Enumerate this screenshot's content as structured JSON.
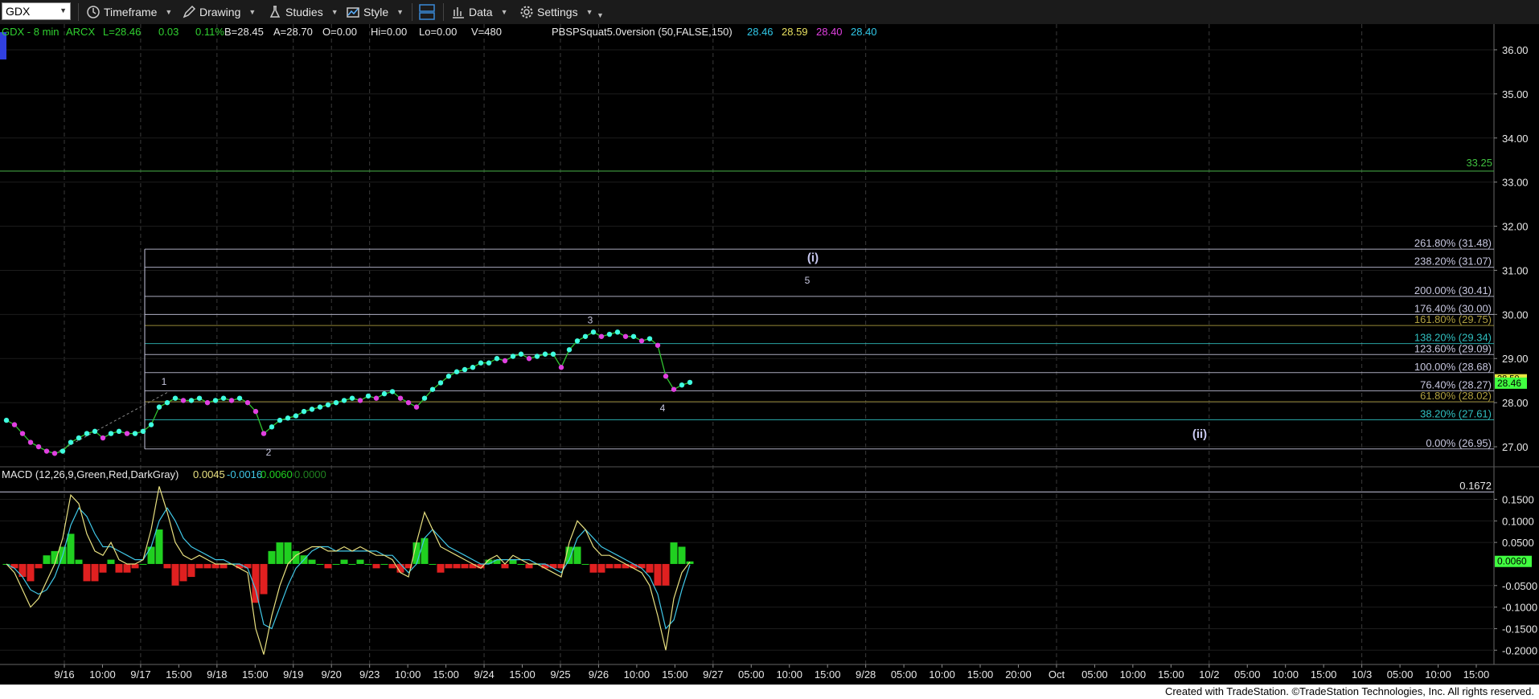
{
  "toolbar": {
    "symbol": "GDX",
    "items": [
      "Timeframe",
      "Drawing",
      "Studies",
      "Style",
      "Data",
      "Settings"
    ]
  },
  "header": {
    "instrument": "GDX - 8 min",
    "exchange": "ARCX",
    "last": "L=28.46",
    "change": "0.03",
    "change_pct": "0.11%",
    "bid": "B=28.45",
    "ask": "A=28.70",
    "ohlc": [
      "O=0.00",
      "Hi=0.00",
      "Lo=0.00",
      "V=480"
    ],
    "study_name": "PBSPSquat5.0version (50,FALSE,150)",
    "study_values": [
      "28.46",
      "28.59",
      "28.40",
      "28.40"
    ],
    "study_colors": [
      "#30c8e8",
      "#e8e060",
      "#e040e0",
      "#30c8e8"
    ]
  },
  "colors": {
    "up": "#00d8d8",
    "dot_up": "#40ffe0",
    "dot_dn": "#e040e0",
    "body": "#30c030",
    "fib_line": "#c8c8e0",
    "green_level": "#40a040",
    "last_price": "#40ff40",
    "hist_pos": "#20d020",
    "hist_neg": "#e02020",
    "macd_line": "#e8e080",
    "signal_line": "#40c8e8"
  },
  "chart_data": [
    {
      "type": "line",
      "title": "GDX - 8 min",
      "x_ticks": [
        "9/16",
        "10:00",
        "9/17",
        "15:00",
        "9/18",
        "15:00",
        "9/19",
        "9/20",
        "9/23",
        "10:00",
        "15:00",
        "9/24",
        "15:00",
        "9/25",
        "9/26",
        "10:00",
        "15:00",
        "9/27",
        "05:00",
        "10:00",
        "15:00",
        "9/28",
        "05:00",
        "10:00",
        "15:00",
        "20:00",
        "Oct",
        "05:00",
        "10:00",
        "15:00",
        "10/2",
        "05:00",
        "10:00",
        "15:00",
        "10/3",
        "05:00",
        "10:00",
        "15:00"
      ],
      "y_ticks": [
        "36.00",
        "35.00",
        "34.00",
        "33.00",
        "32.00",
        "31.00",
        "30.00",
        "29.00",
        "28.00",
        "27.00"
      ],
      "ylim": [
        26.6,
        36.4
      ],
      "series": [
        {
          "x": [
            0,
            1,
            2,
            3,
            4,
            5,
            6,
            7,
            8,
            9,
            10,
            11,
            12,
            13,
            14,
            15,
            16,
            17,
            18,
            19,
            20,
            21,
            22,
            23,
            24,
            25,
            26,
            27,
            28,
            29,
            30,
            31,
            32,
            33,
            34,
            35,
            36,
            37,
            38,
            39,
            40,
            41,
            42,
            43,
            44,
            45,
            46,
            47,
            48,
            49,
            50,
            51,
            52,
            53,
            54,
            55,
            56,
            57,
            58,
            59,
            60,
            61,
            62,
            63,
            64,
            65,
            66,
            67,
            68,
            69,
            70,
            71,
            72,
            73,
            74,
            75,
            76,
            77,
            78,
            79,
            80,
            81,
            82,
            83,
            84,
            85
          ],
          "values": [
            27.6,
            27.5,
            27.3,
            27.1,
            27.0,
            26.9,
            26.85,
            26.9,
            27.1,
            27.2,
            27.3,
            27.35,
            27.2,
            27.3,
            27.35,
            27.3,
            27.3,
            27.35,
            27.5,
            27.9,
            28.0,
            28.1,
            28.05,
            28.05,
            28.1,
            28.0,
            28.05,
            28.1,
            28.05,
            28.1,
            28.0,
            27.8,
            27.3,
            27.45,
            27.6,
            27.65,
            27.7,
            27.8,
            27.85,
            27.9,
            27.95,
            28.0,
            28.05,
            28.1,
            28.05,
            28.15,
            28.1,
            28.2,
            28.25,
            28.1,
            28.0,
            27.9,
            28.1,
            28.3,
            28.45,
            28.6,
            28.7,
            28.75,
            28.8,
            28.9,
            28.9,
            29.0,
            28.95,
            29.05,
            29.1,
            29.0,
            29.05,
            29.1,
            29.1,
            28.8,
            29.2,
            29.4,
            29.5,
            29.6,
            29.5,
            29.55,
            29.6,
            29.5,
            29.5,
            29.4,
            29.45,
            29.3,
            28.6,
            28.3,
            28.4,
            28.46
          ],
          "name": ""
        }
      ],
      "fib_levels": [
        {
          "label": "261.80% (31.48)",
          "value": 31.48
        },
        {
          "label": "238.20% (31.07)",
          "value": 31.07
        },
        {
          "label": "200.00% (30.41)",
          "value": 30.41
        },
        {
          "label": "176.40% (30.00)",
          "value": 30.0
        },
        {
          "label": "161.80% (29.75)",
          "value": 29.75
        },
        {
          "label": "138.20% (29.34)",
          "value": 29.34
        },
        {
          "label": "123.60% (29.09)",
          "value": 29.09
        },
        {
          "label": "100.00% (28.68)",
          "value": 28.68
        },
        {
          "label": "76.40% (28.27)",
          "value": 28.27
        },
        {
          "label": "61.80% (28.02)",
          "value": 28.02
        },
        {
          "label": "38.20% (27.61)",
          "value": 27.61
        },
        {
          "label": "0.00% (26.95)",
          "value": 26.95
        }
      ],
      "fib_label_colors": [
        "#c8c8e0",
        "#c8c8e0",
        "#c8c8e0",
        "#c8c8e0",
        "#b0a040",
        "#30c0c0",
        "#c8c8e0",
        "#c8c8e0",
        "#c8c8e0",
        "#b0a040",
        "#30c0c0",
        "#c8c8e0"
      ],
      "horizontal_level": {
        "label": "33.25",
        "value": 33.25
      },
      "last_price_label": "28.46",
      "other_price_label": "28.50",
      "wave_labels": [
        "1",
        "2",
        "3",
        "4",
        "5",
        "(i)",
        "(ii)"
      ]
    },
    {
      "type": "line",
      "title": "MACD (12,26,9,Green,Red,DarkGray)",
      "legend_values": [
        "0.0045",
        "-0.0016",
        "0.0060",
        "0.0000"
      ],
      "legend_colors": [
        "#e8e080",
        "#40c8e8",
        "#20d020",
        "#208020"
      ],
      "y_ticks": [
        "0.1500",
        "0.1000",
        "0.0500",
        "-0.0500",
        "-0.1000",
        "-0.1500",
        "-0.2000"
      ],
      "ylim": [
        -0.22,
        0.19
      ],
      "level_line": {
        "label": "0.1672",
        "value": 0.1672
      },
      "last_value_label": "0.0060",
      "x": [
        0,
        1,
        2,
        3,
        4,
        5,
        6,
        7,
        8,
        9,
        10,
        11,
        12,
        13,
        14,
        15,
        16,
        17,
        18,
        19,
        20,
        21,
        22,
        23,
        24,
        25,
        26,
        27,
        28,
        29,
        30,
        31,
        32,
        33,
        34,
        35,
        36,
        37,
        38,
        39,
        40,
        41,
        42,
        43,
        44,
        45,
        46,
        47,
        48,
        49,
        50,
        51,
        52,
        53,
        54,
        55,
        56,
        57,
        58,
        59,
        60,
        61,
        62,
        63,
        64,
        65,
        66,
        67,
        68,
        69,
        70,
        71,
        72,
        73,
        74,
        75,
        76,
        77,
        78,
        79,
        80,
        81,
        82,
        83,
        84,
        85
      ],
      "macd": [
        0.0,
        -0.02,
        -0.06,
        -0.1,
        -0.08,
        -0.04,
        0.0,
        0.06,
        0.16,
        0.14,
        0.07,
        0.03,
        0.02,
        0.05,
        0.01,
        0.0,
        0.0,
        0.01,
        0.08,
        0.18,
        0.12,
        0.05,
        0.02,
        0.01,
        0.02,
        0.01,
        0.0,
        0.0,
        0.0,
        -0.01,
        -0.02,
        -0.15,
        -0.21,
        -0.12,
        -0.05,
        0.0,
        0.02,
        0.03,
        0.04,
        0.04,
        0.03,
        0.03,
        0.04,
        0.03,
        0.04,
        0.03,
        0.02,
        0.02,
        0.01,
        -0.02,
        -0.03,
        0.05,
        0.12,
        0.08,
        0.04,
        0.03,
        0.02,
        0.01,
        0.0,
        -0.01,
        0.01,
        0.02,
        0.0,
        0.02,
        0.01,
        0.0,
        0.0,
        -0.01,
        -0.02,
        -0.03,
        0.05,
        0.1,
        0.08,
        0.04,
        0.02,
        0.02,
        0.01,
        0.0,
        -0.01,
        -0.02,
        -0.05,
        -0.12,
        -0.2,
        -0.08,
        -0.02,
        0.0045
      ],
      "signal": [
        0.0,
        -0.01,
        -0.03,
        -0.06,
        -0.07,
        -0.06,
        -0.03,
        0.02,
        0.09,
        0.13,
        0.11,
        0.07,
        0.04,
        0.04,
        0.03,
        0.02,
        0.01,
        0.01,
        0.04,
        0.1,
        0.13,
        0.1,
        0.06,
        0.04,
        0.03,
        0.02,
        0.01,
        0.01,
        0.0,
        0.0,
        -0.01,
        -0.06,
        -0.14,
        -0.15,
        -0.1,
        -0.05,
        -0.01,
        0.01,
        0.03,
        0.04,
        0.04,
        0.03,
        0.03,
        0.03,
        0.03,
        0.03,
        0.03,
        0.02,
        0.02,
        0.0,
        -0.02,
        0.0,
        0.06,
        0.08,
        0.06,
        0.04,
        0.03,
        0.02,
        0.01,
        0.0,
        0.0,
        0.01,
        0.01,
        0.01,
        0.01,
        0.01,
        0.0,
        0.0,
        -0.01,
        -0.02,
        0.01,
        0.06,
        0.08,
        0.06,
        0.04,
        0.03,
        0.02,
        0.01,
        0.0,
        -0.01,
        -0.03,
        -0.07,
        -0.15,
        -0.13,
        -0.06,
        -0.0016
      ],
      "histogram": [
        0.0,
        -0.01,
        -0.03,
        -0.04,
        -0.01,
        0.02,
        0.03,
        0.04,
        0.07,
        0.01,
        -0.04,
        -0.04,
        -0.02,
        0.01,
        -0.02,
        -0.02,
        -0.01,
        0.0,
        0.04,
        0.08,
        -0.01,
        -0.05,
        -0.04,
        -0.03,
        -0.01,
        -0.01,
        -0.01,
        -0.01,
        0.0,
        -0.01,
        -0.01,
        -0.09,
        -0.07,
        0.03,
        0.05,
        0.05,
        0.03,
        0.02,
        0.01,
        0.0,
        -0.01,
        0.0,
        0.01,
        0.0,
        0.01,
        0.0,
        -0.01,
        0.0,
        -0.01,
        -0.02,
        -0.01,
        0.05,
        0.06,
        0.0,
        -0.02,
        -0.01,
        -0.01,
        -0.01,
        -0.01,
        -0.01,
        0.01,
        0.01,
        -0.01,
        0.01,
        0.0,
        -0.01,
        0.0,
        -0.01,
        -0.01,
        -0.01,
        0.04,
        0.04,
        0.0,
        -0.02,
        -0.02,
        -0.01,
        -0.01,
        -0.01,
        -0.01,
        -0.01,
        -0.02,
        -0.05,
        -0.05,
        0.05,
        0.04,
        0.006
      ]
    }
  ],
  "footer": "Created with TradeStation. ©TradeStation Technologies, Inc. All rights reserved."
}
